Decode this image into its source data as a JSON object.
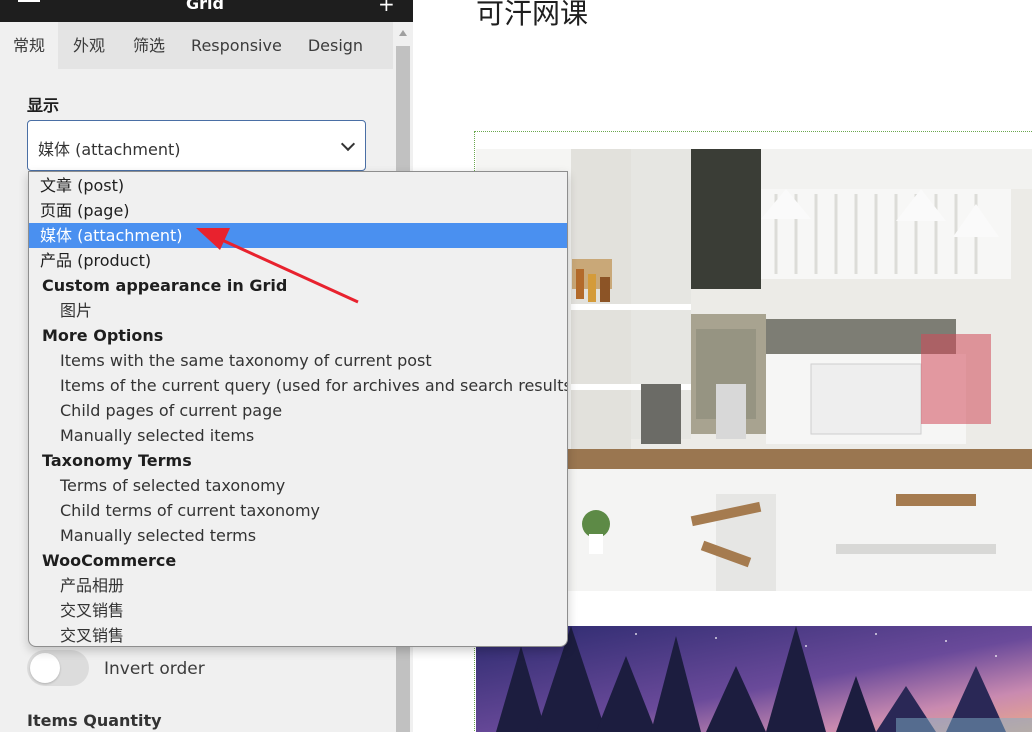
{
  "colors": {
    "accent": "#4a90f0",
    "arrow": "#e8222e",
    "panel_bg": "#f0f0f0",
    "topbar_bg": "#1e1e1e"
  },
  "topbar": {
    "title": "Grid",
    "menu_icon": "hamburger-icon",
    "add_icon": "plus-icon"
  },
  "tabs": [
    {
      "label": "常规"
    },
    {
      "label": "外观"
    },
    {
      "label": "筛选"
    },
    {
      "label": "Responsive"
    },
    {
      "label": "Design"
    }
  ],
  "display": {
    "label": "显示",
    "selected": "媒体 (attachment)"
  },
  "dropdown": {
    "options": [
      {
        "label": "文章 (post)"
      },
      {
        "label": "页面 (page)"
      },
      {
        "label": "媒体 (attachment)"
      },
      {
        "label": "产品 (product)"
      },
      {
        "label": "Custom appearance in Grid"
      },
      {
        "label": "图片"
      },
      {
        "label": "More Options"
      },
      {
        "label": "Items with the same taxonomy of current post"
      },
      {
        "label": "Items of the current query (used for archives and search results)"
      },
      {
        "label": "Child pages of current page"
      },
      {
        "label": "Manually selected items"
      },
      {
        "label": "Taxonomy Terms"
      },
      {
        "label": "Terms of selected taxonomy"
      },
      {
        "label": "Child terms of current taxonomy"
      },
      {
        "label": "Manually selected terms"
      },
      {
        "label": "WooCommerce"
      },
      {
        "label": "产品相册"
      },
      {
        "label": "交叉销售"
      },
      {
        "label": "交叉销售"
      }
    ]
  },
  "invert_order": {
    "label": "Invert order",
    "checked": false
  },
  "items_quantity": {
    "label": "Items Quantity"
  },
  "preview": {
    "title": "可汗网课"
  }
}
